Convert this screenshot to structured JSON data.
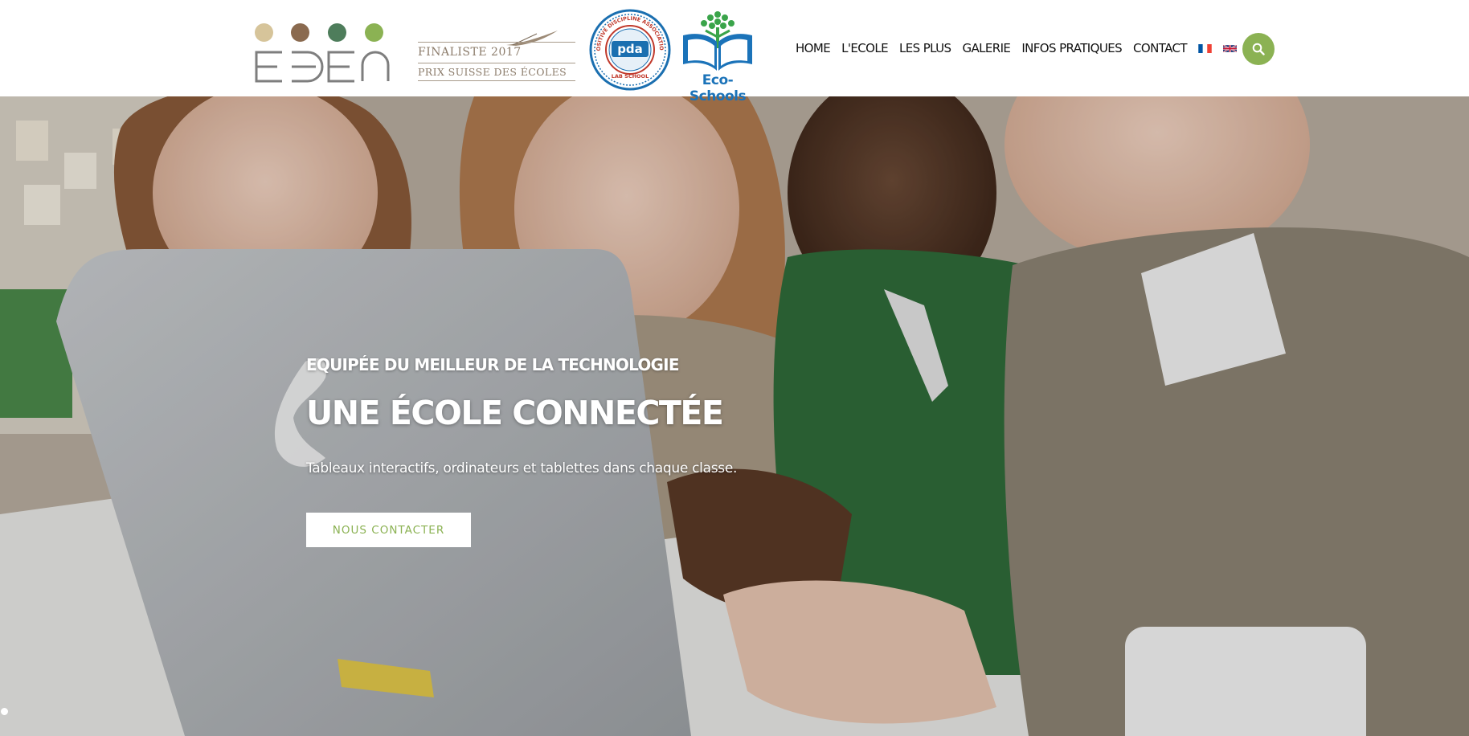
{
  "header": {
    "logo": {
      "text": "EDEN",
      "dot_colors": [
        "#d6c49a",
        "#8a6a4f",
        "#4e7d5b",
        "#8bb253"
      ]
    },
    "badges": {
      "prix": {
        "line1": "FINALISTE 2017",
        "line2": "PRIX SUISSE DES ÉCOLES"
      },
      "pda": {
        "ring_text": "POSITIVE DISCIPLINE ASSOCIATION",
        "bottom_text": "LAB SCHOOL",
        "center": "pda"
      },
      "eco": {
        "label": "Eco-Schools"
      }
    },
    "nav": {
      "items": [
        "HOME",
        "L'ECOLE",
        "LES PLUS",
        "GALERIE",
        "INFOS PRATIQUES",
        "CONTACT"
      ],
      "languages": [
        "fr-flag-icon",
        "uk-flag-icon"
      ]
    },
    "search_icon": "search-icon",
    "accent_color": "#8bb253"
  },
  "hero": {
    "eyebrow": "EQUIPÉE DU MEILLEUR DE LA TECHNOLOGIE",
    "title": "UNE ÉCOLE CONNECTÉE",
    "description": "Tableaux interactifs, ordinateurs et tablettes dans chaque classe.",
    "cta_label": "NOUS CONTACTER"
  }
}
